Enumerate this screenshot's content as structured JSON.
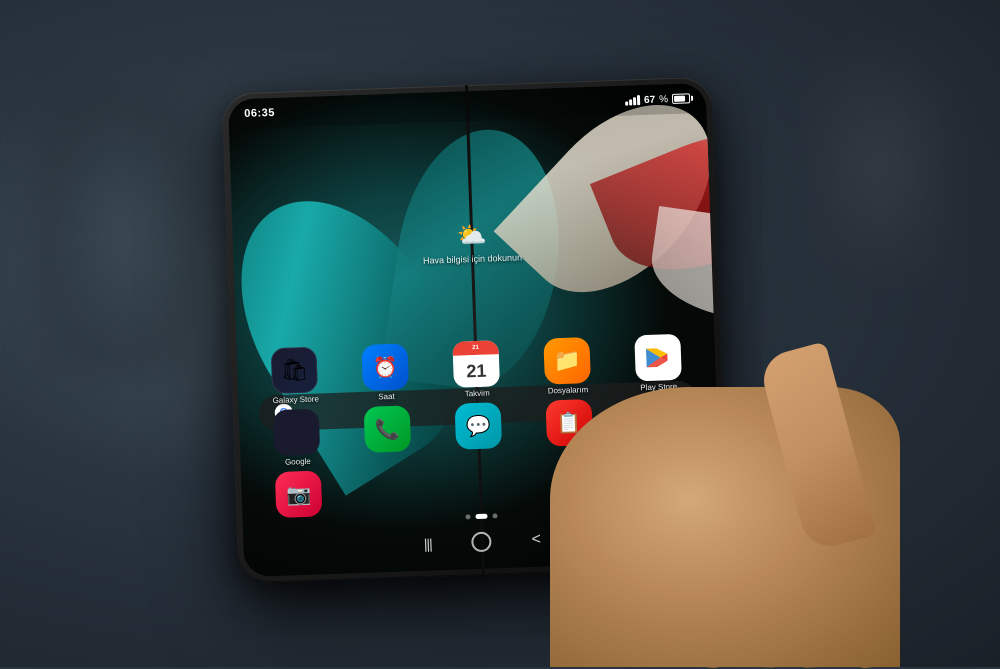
{
  "scene": {
    "background_color": "#2a3540"
  },
  "phone": {
    "status_bar": {
      "time": "06:35",
      "battery_percent": "67",
      "settings_icon": "⚙"
    },
    "weather": {
      "icon": "⛅",
      "text": "Hava bilgisi için dokunun"
    },
    "search_bar": {
      "google_letter": "G",
      "mic_icon": "🎤"
    },
    "apps": [
      {
        "id": "galaxy-store",
        "label": "Galaxy Store",
        "icon_type": "galaxy-store"
      },
      {
        "id": "saat",
        "label": "Saat",
        "icon_type": "saat"
      },
      {
        "id": "takvim",
        "label": "Takvim",
        "icon_type": "takvim",
        "cal_day": "21"
      },
      {
        "id": "dosyalarim",
        "label": "Dosyalarım",
        "icon_type": "dosyalarim"
      },
      {
        "id": "play-store",
        "label": "Play Store",
        "icon_type": "play-store"
      },
      {
        "id": "google",
        "label": "Google",
        "icon_type": "google"
      },
      {
        "id": "phone",
        "label": "",
        "icon_type": "phone"
      },
      {
        "id": "messages",
        "label": "",
        "icon_type": "messages"
      },
      {
        "id": "clipboard",
        "label": "",
        "icon_type": "clipboard"
      },
      {
        "id": "flower",
        "label": "",
        "icon_type": "flower"
      },
      {
        "id": "camera",
        "label": "",
        "icon_type": "camera"
      }
    ],
    "navigation": {
      "recents": "|||",
      "home": "○",
      "back": "<"
    }
  }
}
